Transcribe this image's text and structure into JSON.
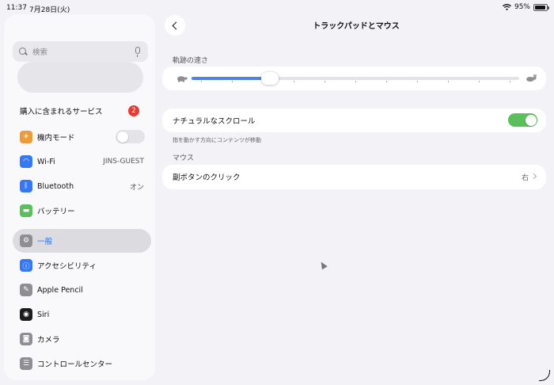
{
  "status_bar": {
    "time": "11:37",
    "date": "7月28日(火)",
    "battery_percent": "95%",
    "battery_level": 0.95
  },
  "sidebar": {
    "search_placeholder": "検索",
    "services_label": "購入に含まれるサービス",
    "services_badge": "2",
    "items": [
      {
        "label": "機内モード",
        "icon": "airplane-icon",
        "icon_color": "#f09a37",
        "toggle": false
      },
      {
        "label": "Wi-Fi",
        "icon": "wifi-icon",
        "icon_color": "#3478f6",
        "value": "JINS-GUEST"
      },
      {
        "label": "Bluetooth",
        "icon": "bluetooth-icon",
        "icon_color": "#3478f6",
        "value": "オン"
      },
      {
        "label": "バッテリー",
        "icon": "battery-icon",
        "icon_color": "#5ac05a"
      },
      {
        "label": "一般",
        "icon": "gear-icon",
        "icon_color": "#8e8e93",
        "selected": true
      },
      {
        "label": "アクセシビリティ",
        "icon": "accessibility-icon",
        "icon_color": "#3478f6"
      },
      {
        "label": "Apple Pencil",
        "icon": "pencil-icon",
        "icon_color": "#8e8e93"
      },
      {
        "label": "Siri",
        "icon": "siri-icon",
        "icon_color": "#1c1c1e"
      },
      {
        "label": "カメラ",
        "icon": "camera-icon",
        "icon_color": "#8e8e93"
      },
      {
        "label": "コントロールセンター",
        "icon": "control-center-icon",
        "icon_color": "#8e8e93"
      }
    ]
  },
  "main": {
    "title": "トラックパッドとマウス",
    "tracking_label": "軌跡の速さ",
    "tracking_value": 0.24,
    "tracking_steps": 11,
    "natural_scroll_label": "ナチュラルなスクロール",
    "natural_scroll_on": true,
    "natural_scroll_note": "指を動かす方向にコンテンツが移動",
    "mouse_section": "マウス",
    "secondary_click_label": "副ボタンのクリック",
    "secondary_click_value": "右"
  },
  "colors": {
    "accent": "#2c6fe6",
    "toggle_on": "#5ac05a",
    "toggle_off": "#e3e3e8",
    "badge": "#e83a30"
  }
}
